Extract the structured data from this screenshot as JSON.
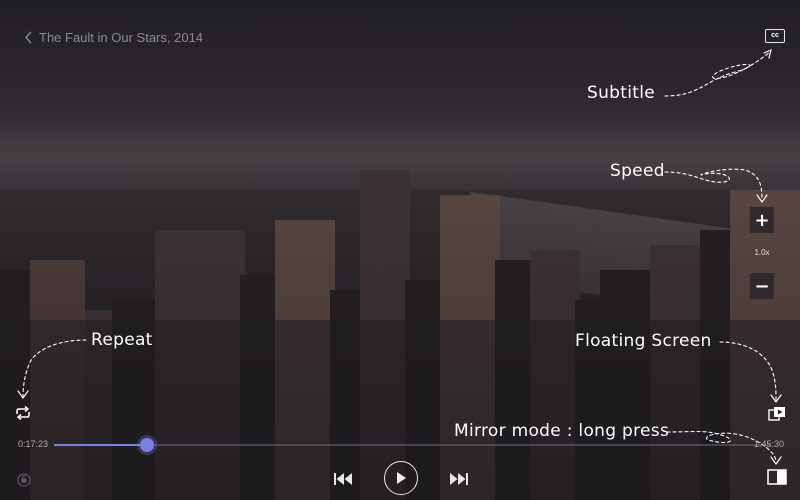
{
  "player": {
    "title": "The Fault in Our Stars, 2014",
    "cc_label": "cc"
  },
  "hints": {
    "subtitle": "Subtitle",
    "speed": "Speed",
    "repeat": "Repeat",
    "floating_screen": "Floating Screen",
    "mirror_mode": "Mirror mode : long press"
  },
  "speed_control": {
    "increase_label": "+",
    "value": "1.0x",
    "decrease_label": "−"
  },
  "seek": {
    "elapsed": "0:17:23",
    "total": "1:45:30",
    "progress": 0.13,
    "accent_color": "#7b7fe6"
  },
  "icons": {
    "back": "chevron-left-icon",
    "cc": "closed-caption-icon",
    "repeat": "repeat-icon",
    "floating": "floating-screen-icon",
    "mirror": "mirror-mode-icon",
    "lock": "lock-icon",
    "previous": "skip-previous-icon",
    "play": "play-icon",
    "next": "skip-next-icon"
  }
}
